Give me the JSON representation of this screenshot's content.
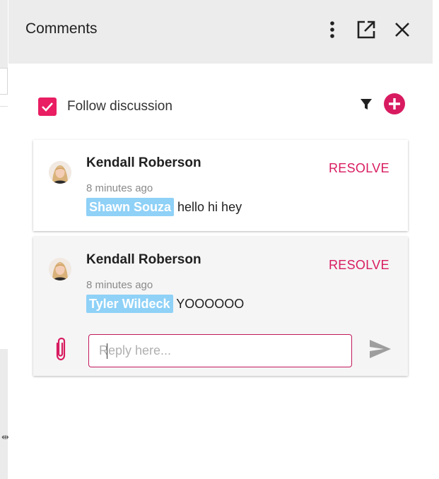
{
  "panel": {
    "title": "Comments",
    "icons": [
      "more-vertical-icon",
      "open-external-icon",
      "close-icon"
    ]
  },
  "follow": {
    "label": "Follow discussion",
    "checked": true
  },
  "colors": {
    "accent": "#e91e63",
    "mention_bg": "#8fd1f7",
    "header_bg": "#ececec"
  },
  "comments": [
    {
      "author": "Kendall Roberson",
      "time": "8 minutes ago",
      "mention": "Shawn Souza",
      "text": " hello hi hey",
      "resolve_label": "RESOLVE"
    },
    {
      "author": "Kendall Roberson",
      "time": "8 minutes ago",
      "mention": "Tyler Wildeck",
      "text": " YOOOOOO",
      "resolve_label": "RESOLVE",
      "reply": {
        "placeholder": "Reply here...",
        "value": ""
      }
    }
  ]
}
